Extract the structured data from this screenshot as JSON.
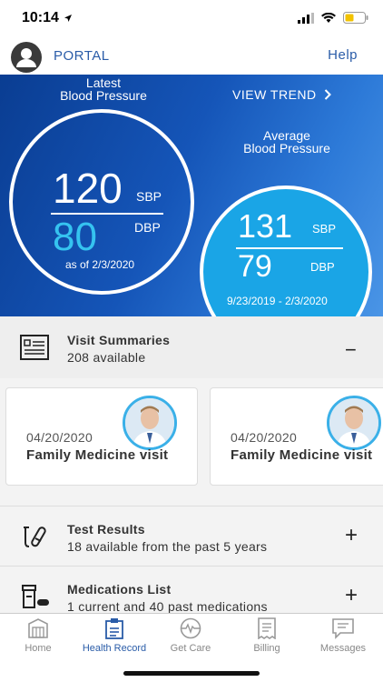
{
  "status_bar": {
    "time": "10:14"
  },
  "header": {
    "portal_label": "PORTAL",
    "help_label": "Help"
  },
  "blood_pressure": {
    "latest": {
      "title_line1": "Latest",
      "title_line2": "Blood Pressure",
      "sbp": "120",
      "sbp_unit": "SBP",
      "dbp": "80",
      "dbp_unit": "DBP",
      "as_of": "as of 2/3/2020"
    },
    "view_trend_label": "VIEW TREND",
    "average": {
      "title_line1": "Average",
      "title_line2": "Blood Pressure",
      "sbp": "131",
      "sbp_unit": "SBP",
      "dbp": "79",
      "dbp_unit": "DBP",
      "range": "9/23/2019 - 2/3/2020"
    }
  },
  "visit_summaries": {
    "title": "Visit Summaries",
    "subtitle": "208 available",
    "toggle": "−",
    "cards": [
      {
        "date": "04/20/2020",
        "title": "Family Medicine visit"
      },
      {
        "date": "04/20/2020",
        "title": "Family Medicine visit"
      }
    ]
  },
  "test_results": {
    "title": "Test Results",
    "subtitle": "18 available from the past 5 years",
    "toggle": "+"
  },
  "medications": {
    "title": "Medications List",
    "subtitle": "1 current and 40 past medications",
    "toggle": "+"
  },
  "tabs": [
    {
      "label": "Home",
      "icon": "home-icon"
    },
    {
      "label": "Health Record",
      "icon": "health-record-icon"
    },
    {
      "label": "Get Care",
      "icon": "get-care-icon"
    },
    {
      "label": "Billing",
      "icon": "billing-icon"
    },
    {
      "label": "Messages",
      "icon": "messages-icon"
    }
  ],
  "colors": {
    "accent": "#2a5ca8",
    "banner_dark": "#0a3d92",
    "banner_light": "#4a95e6",
    "dbp_highlight": "#35c3f0",
    "avg_circle": "#1aa5e6"
  }
}
